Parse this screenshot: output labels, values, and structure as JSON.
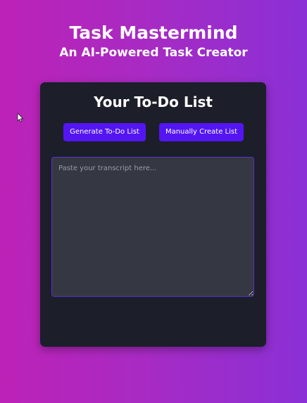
{
  "header": {
    "title": "Task Mastermind",
    "subtitle": "An AI-Powered Task Creator"
  },
  "card": {
    "title": "Your To-Do List",
    "generate_label": "Generate To-Do List",
    "manual_label": "Manually Create List",
    "transcript": {
      "value": "",
      "placeholder": "Paste your transcript here..."
    }
  },
  "colors": {
    "background_start": "#bd22b6",
    "background_end": "#8a30d6",
    "card": "#1c1e2a",
    "button": "#5316f2",
    "textarea": "#353842"
  },
  "icons": {
    "cursor": "mouse-pointer-icon"
  }
}
